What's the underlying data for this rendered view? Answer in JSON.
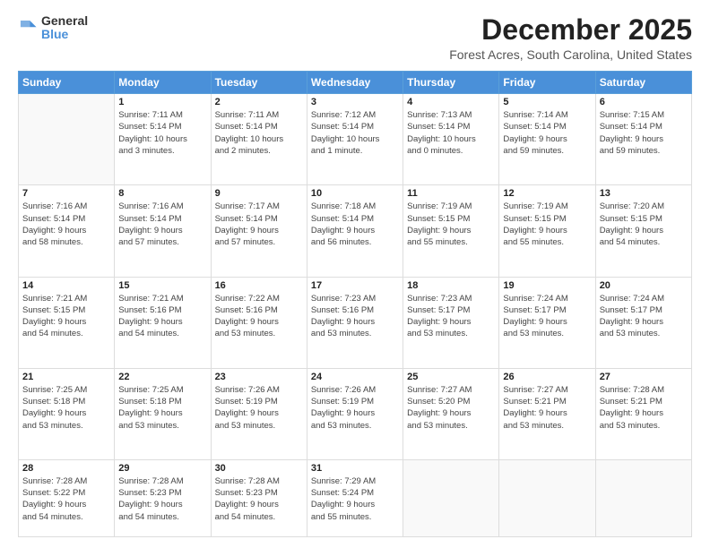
{
  "logo": {
    "text_general": "General",
    "text_blue": "Blue"
  },
  "title": "December 2025",
  "subtitle": "Forest Acres, South Carolina, United States",
  "days_of_week": [
    "Sunday",
    "Monday",
    "Tuesday",
    "Wednesday",
    "Thursday",
    "Friday",
    "Saturday"
  ],
  "weeks": [
    [
      {
        "day": "",
        "info": ""
      },
      {
        "day": "1",
        "info": "Sunrise: 7:11 AM\nSunset: 5:14 PM\nDaylight: 10 hours\nand 3 minutes."
      },
      {
        "day": "2",
        "info": "Sunrise: 7:11 AM\nSunset: 5:14 PM\nDaylight: 10 hours\nand 2 minutes."
      },
      {
        "day": "3",
        "info": "Sunrise: 7:12 AM\nSunset: 5:14 PM\nDaylight: 10 hours\nand 1 minute."
      },
      {
        "day": "4",
        "info": "Sunrise: 7:13 AM\nSunset: 5:14 PM\nDaylight: 10 hours\nand 0 minutes."
      },
      {
        "day": "5",
        "info": "Sunrise: 7:14 AM\nSunset: 5:14 PM\nDaylight: 9 hours\nand 59 minutes."
      },
      {
        "day": "6",
        "info": "Sunrise: 7:15 AM\nSunset: 5:14 PM\nDaylight: 9 hours\nand 59 minutes."
      }
    ],
    [
      {
        "day": "7",
        "info": "Sunrise: 7:16 AM\nSunset: 5:14 PM\nDaylight: 9 hours\nand 58 minutes."
      },
      {
        "day": "8",
        "info": "Sunrise: 7:16 AM\nSunset: 5:14 PM\nDaylight: 9 hours\nand 57 minutes."
      },
      {
        "day": "9",
        "info": "Sunrise: 7:17 AM\nSunset: 5:14 PM\nDaylight: 9 hours\nand 57 minutes."
      },
      {
        "day": "10",
        "info": "Sunrise: 7:18 AM\nSunset: 5:14 PM\nDaylight: 9 hours\nand 56 minutes."
      },
      {
        "day": "11",
        "info": "Sunrise: 7:19 AM\nSunset: 5:15 PM\nDaylight: 9 hours\nand 55 minutes."
      },
      {
        "day": "12",
        "info": "Sunrise: 7:19 AM\nSunset: 5:15 PM\nDaylight: 9 hours\nand 55 minutes."
      },
      {
        "day": "13",
        "info": "Sunrise: 7:20 AM\nSunset: 5:15 PM\nDaylight: 9 hours\nand 54 minutes."
      }
    ],
    [
      {
        "day": "14",
        "info": "Sunrise: 7:21 AM\nSunset: 5:15 PM\nDaylight: 9 hours\nand 54 minutes."
      },
      {
        "day": "15",
        "info": "Sunrise: 7:21 AM\nSunset: 5:16 PM\nDaylight: 9 hours\nand 54 minutes."
      },
      {
        "day": "16",
        "info": "Sunrise: 7:22 AM\nSunset: 5:16 PM\nDaylight: 9 hours\nand 53 minutes."
      },
      {
        "day": "17",
        "info": "Sunrise: 7:23 AM\nSunset: 5:16 PM\nDaylight: 9 hours\nand 53 minutes."
      },
      {
        "day": "18",
        "info": "Sunrise: 7:23 AM\nSunset: 5:17 PM\nDaylight: 9 hours\nand 53 minutes."
      },
      {
        "day": "19",
        "info": "Sunrise: 7:24 AM\nSunset: 5:17 PM\nDaylight: 9 hours\nand 53 minutes."
      },
      {
        "day": "20",
        "info": "Sunrise: 7:24 AM\nSunset: 5:17 PM\nDaylight: 9 hours\nand 53 minutes."
      }
    ],
    [
      {
        "day": "21",
        "info": "Sunrise: 7:25 AM\nSunset: 5:18 PM\nDaylight: 9 hours\nand 53 minutes."
      },
      {
        "day": "22",
        "info": "Sunrise: 7:25 AM\nSunset: 5:18 PM\nDaylight: 9 hours\nand 53 minutes."
      },
      {
        "day": "23",
        "info": "Sunrise: 7:26 AM\nSunset: 5:19 PM\nDaylight: 9 hours\nand 53 minutes."
      },
      {
        "day": "24",
        "info": "Sunrise: 7:26 AM\nSunset: 5:19 PM\nDaylight: 9 hours\nand 53 minutes."
      },
      {
        "day": "25",
        "info": "Sunrise: 7:27 AM\nSunset: 5:20 PM\nDaylight: 9 hours\nand 53 minutes."
      },
      {
        "day": "26",
        "info": "Sunrise: 7:27 AM\nSunset: 5:21 PM\nDaylight: 9 hours\nand 53 minutes."
      },
      {
        "day": "27",
        "info": "Sunrise: 7:28 AM\nSunset: 5:21 PM\nDaylight: 9 hours\nand 53 minutes."
      }
    ],
    [
      {
        "day": "28",
        "info": "Sunrise: 7:28 AM\nSunset: 5:22 PM\nDaylight: 9 hours\nand 54 minutes."
      },
      {
        "day": "29",
        "info": "Sunrise: 7:28 AM\nSunset: 5:23 PM\nDaylight: 9 hours\nand 54 minutes."
      },
      {
        "day": "30",
        "info": "Sunrise: 7:28 AM\nSunset: 5:23 PM\nDaylight: 9 hours\nand 54 minutes."
      },
      {
        "day": "31",
        "info": "Sunrise: 7:29 AM\nSunset: 5:24 PM\nDaylight: 9 hours\nand 55 minutes."
      },
      {
        "day": "",
        "info": ""
      },
      {
        "day": "",
        "info": ""
      },
      {
        "day": "",
        "info": ""
      }
    ]
  ]
}
